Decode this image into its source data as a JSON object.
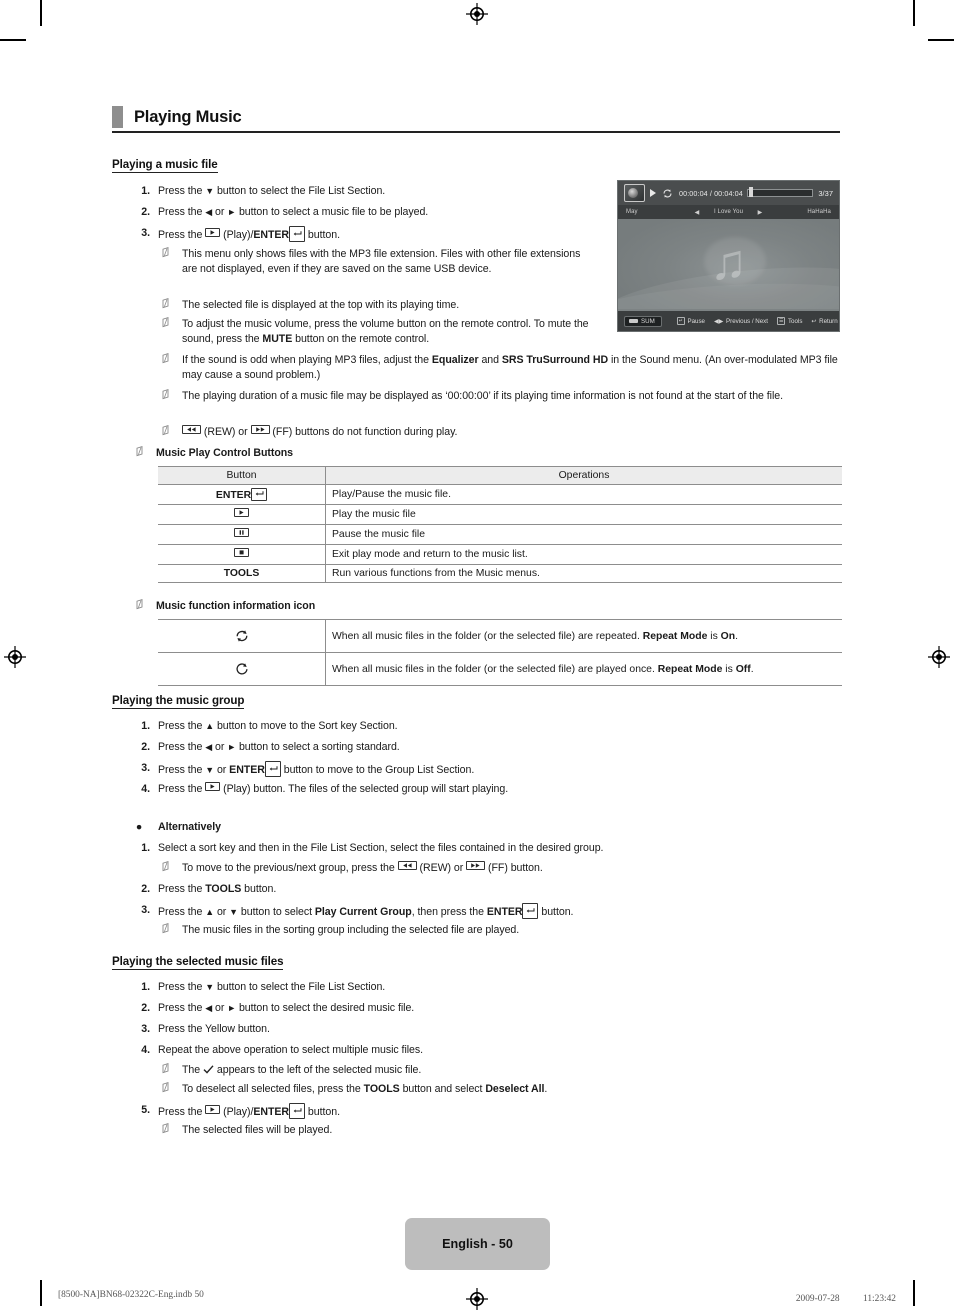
{
  "document": {
    "section_title": "Playing Music",
    "page_badge": "English - 50",
    "print_left": "[8500-NA]BN68-02322C-Eng.indb   50",
    "print_right": "2009-07-28   　　 11:23:42"
  },
  "tv_screenshot": {
    "time": "00:00:04 / 00:04:04",
    "track_count": "3/37",
    "prev_label": "May",
    "now_playing": "I Love You",
    "next_label": "HaHaHa",
    "left_arrow": "◀",
    "right_arrow": "▶",
    "source_label": "SUM",
    "hints": [
      {
        "key": "↵",
        "label": "Pause"
      },
      {
        "key": "◀▶",
        "label": "Previous / Next"
      },
      {
        "key": "☰",
        "label": "Tools"
      },
      {
        "key": "↩",
        "label": "Return"
      }
    ],
    "note_glyph": "♫"
  },
  "section_playing_file": {
    "heading": "Playing a music file",
    "steps": [
      {
        "num": "1.",
        "pre": "Press the ",
        "glyph": "down",
        "post": " button to select the File List Section."
      },
      {
        "num": "2.",
        "pre": "Press the ",
        "glyph": "leftright",
        "post": " button to select a music file to be played."
      },
      {
        "num": "3.",
        "pre": "Press the ",
        "glyph": "play-enter",
        "post": " button."
      }
    ],
    "notes": [
      "This menu only shows files with the MP3 file extension. Files with other file extensions are not displayed, even if they are saved on the same USB device.",
      "The selected file is displayed at the top with its playing time.",
      "To adjust the music volume, press the volume button on the remote control. To mute the sound, press the MUTE button on the remote control.",
      "If the sound is odd when playing MP3 files, adjust the Equalizer and SRS TruSurround HD in the Sound menu. (An over-modulated MP3 file may cause a sound problem.)",
      "The playing duration of a music file may be displayed as ‘00:00:00’ if its playing time information is not found at the start of the file.",
      "(REW) or (FF) buttons do not function during play."
    ],
    "note_bolds": {
      "mute": "MUTE",
      "equalizer": "Equalizer",
      "srs": "SRS TruSurround HD"
    },
    "control_buttons_title": "Music Play Control Buttons"
  },
  "control_table": {
    "headers": [
      "Button",
      "Operations"
    ],
    "rows": [
      {
        "button": "ENTER",
        "button_icon": "enter-key",
        "operation": "Play/Pause the music file."
      },
      {
        "button": "",
        "button_icon": "play-key",
        "operation": "Play the music file"
      },
      {
        "button": "",
        "button_icon": "pause-key",
        "operation": "Pause the music file"
      },
      {
        "button": "",
        "button_icon": "stop-key",
        "operation": "Exit play mode and return to the music list."
      },
      {
        "button": "TOOLS",
        "button_icon": "",
        "operation": "Run various functions from the Music menus."
      }
    ]
  },
  "info_icon_table": {
    "title": "Music function information icon",
    "rows": [
      {
        "icon": "repeat-all-icon",
        "text_pre": "When all music files in the folder (or the selected file) are repeated. ",
        "bold1": "Repeat Mode",
        "text_mid": " is ",
        "bold2": "On",
        "text_post": "."
      },
      {
        "icon": "repeat-off-icon",
        "text_pre": "When all music files in the folder (or the selected file) are played once. ",
        "bold1": "Repeat Mode",
        "text_mid": " is ",
        "bold2": "Off",
        "text_post": "."
      }
    ]
  },
  "section_music_group": {
    "heading": "Playing the music group",
    "steps": [
      {
        "num": "1.",
        "text": "Press the ▲ button to move to the Sort key Section."
      },
      {
        "num": "2.",
        "text": "Press the ◀ or ▶ button to select a sorting standard."
      },
      {
        "num": "3.",
        "text": "Press the ▼ or ENTER button to move to the Group List Section."
      },
      {
        "num": "4.",
        "text": "Press the (Play) button. The files of the selected group will start playing."
      }
    ]
  },
  "section_alternatively": {
    "heading": "Alternatively",
    "steps": [
      {
        "num": "1.",
        "text": "Select a sort key and then in the File List Section, select the files contained in the desired group."
      },
      {
        "num": "2.",
        "text": "Press the TOOLS button."
      },
      {
        "num": "3.",
        "text": "Press the ▲ or ▼ button to select Play Current Group, then press the ENTER button."
      }
    ],
    "notes": [
      "To move to the previous/next group, press the (REW) or (FF) button.",
      "The music files in the sorting group including the selected file are played."
    ],
    "bolds": {
      "tools": "TOOLS",
      "play_current_group": "Play Current Group",
      "enter": "ENTER"
    }
  },
  "section_selected_files": {
    "heading": "Playing the selected music files",
    "steps": [
      {
        "num": "1.",
        "text": "Press the ▼ button to select the File List Section."
      },
      {
        "num": "2.",
        "text": "Press the ◀ or ▶ button to select the desired music file."
      },
      {
        "num": "3.",
        "text": "Press the Yellow button."
      },
      {
        "num": "4.",
        "text": "Repeat the above operation to select multiple music files."
      },
      {
        "num": "5.",
        "text": "Press the (Play)/ENTER button."
      }
    ],
    "notes": [
      "The ✓ appears to the left of the selected music file.",
      "To deselect all selected files, press the TOOLS button and select Deselect All.",
      "The selected files will be played."
    ],
    "bolds": {
      "tools": "TOOLS",
      "deselect_all": "Deselect All"
    }
  }
}
